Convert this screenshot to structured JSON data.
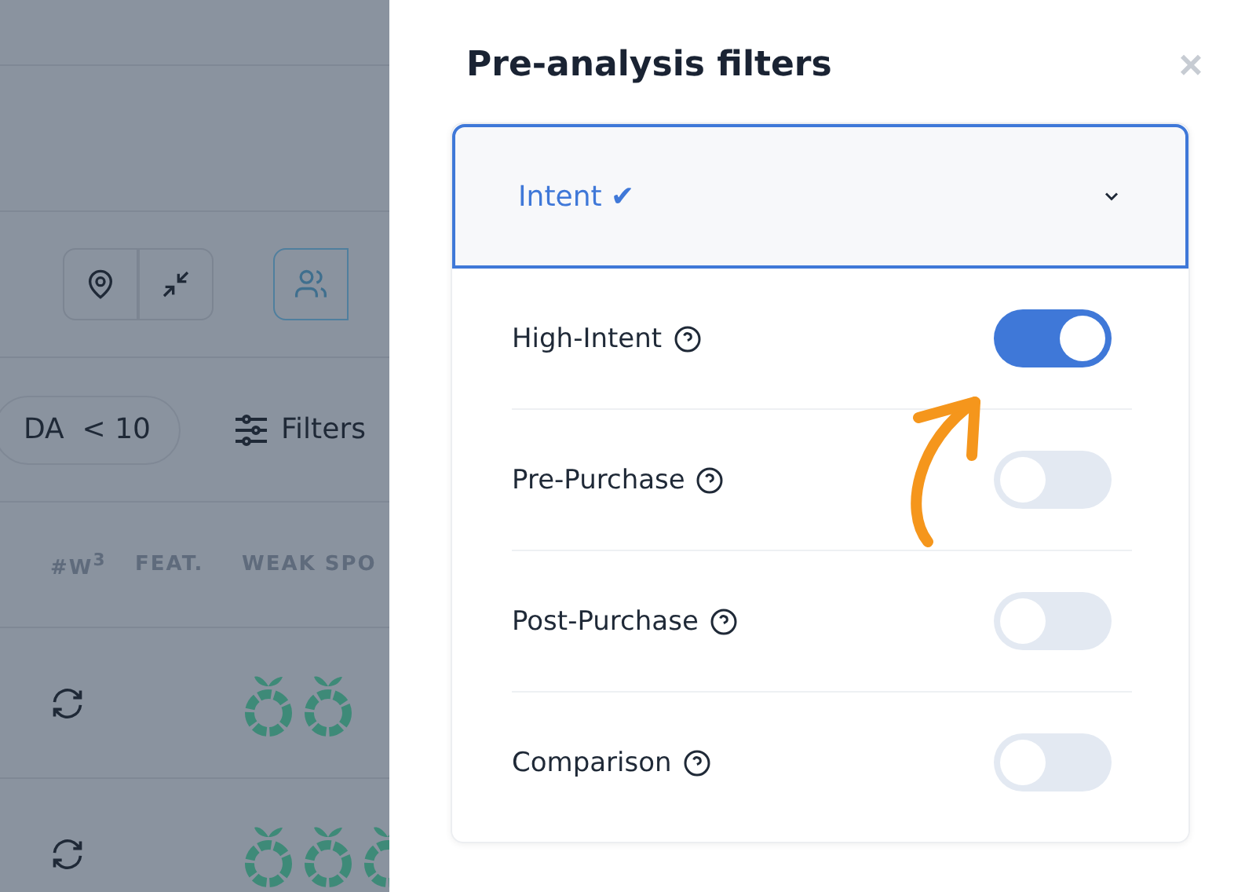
{
  "background": {
    "toolbar_buttons": [
      {
        "selected": false
      },
      {
        "selected": false
      }
    ],
    "view_buttons": [
      {
        "selected": true
      }
    ],
    "filter_pill": "DA  < 10",
    "filters_button": "Filters",
    "columns": [
      "#W$^{3}$",
      "FEAT.",
      "WEAK SPO"
    ]
  },
  "panel": {
    "title": "Pre-analysis filters",
    "close": "×",
    "section": {
      "title": "Intent ✔",
      "expanded": true,
      "options": [
        {
          "label": "High-Intent",
          "on": true
        },
        {
          "label": "Pre-Purchase",
          "on": false
        },
        {
          "label": "Post-Purchase",
          "on": false
        },
        {
          "label": "Comparison",
          "on": false
        }
      ]
    }
  }
}
